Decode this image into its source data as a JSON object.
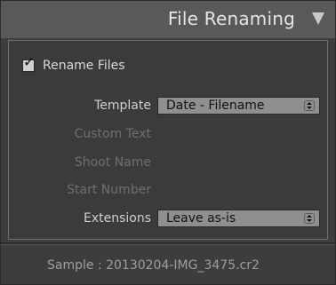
{
  "header": {
    "title": "File Renaming",
    "collapse_icon": "triangle-down-icon"
  },
  "rename_files": {
    "label": "Rename Files",
    "checked": true,
    "check_glyph": "✓"
  },
  "fields": {
    "template": {
      "label": "Template",
      "value": "Date - Filename"
    },
    "custom_text": {
      "label": "Custom Text"
    },
    "shoot_name": {
      "label": "Shoot Name"
    },
    "start_number": {
      "label": "Start Number"
    },
    "extensions": {
      "label": "Extensions",
      "value": "Leave as-is"
    }
  },
  "sample": {
    "text": "Sample : 20130204-IMG_3475.cr2"
  },
  "colors": {
    "header_bg": "#595959",
    "panel_bg": "#3b3b3b",
    "select_bg": "#8f8f8f",
    "label_active": "#cfcfcf",
    "label_dim": "#6f6f6f"
  }
}
